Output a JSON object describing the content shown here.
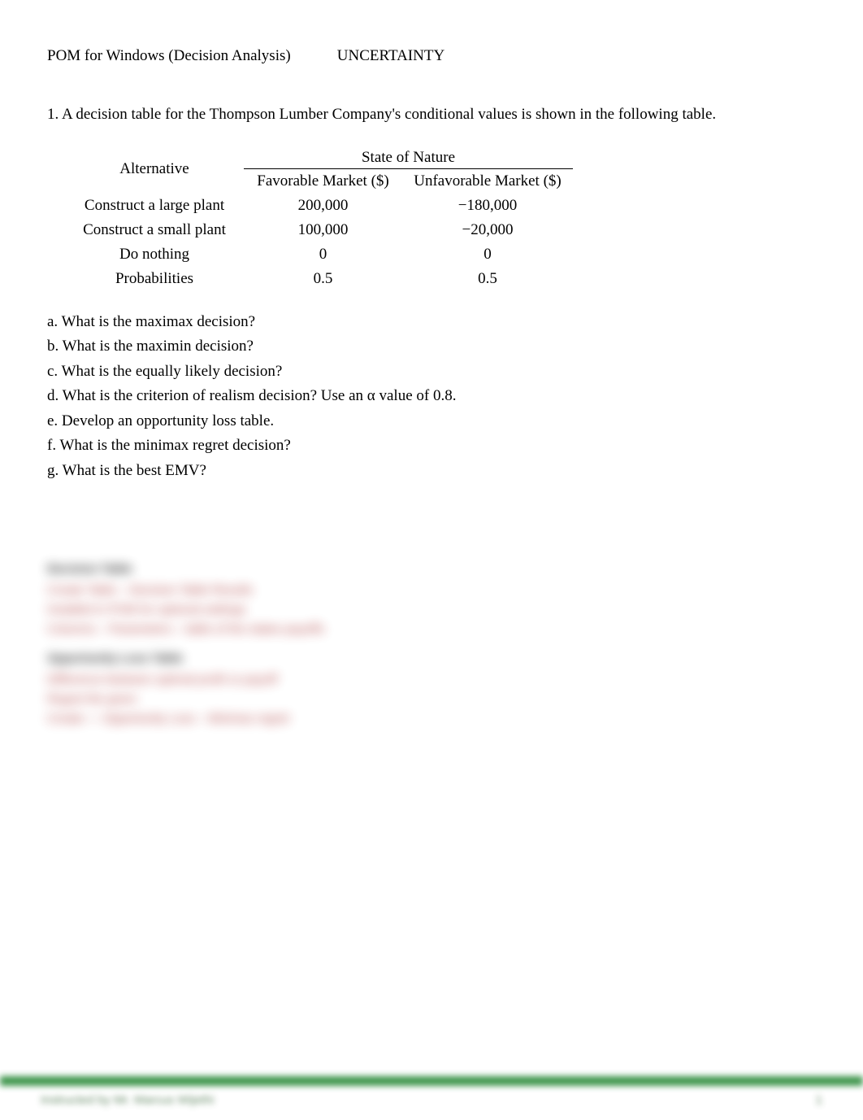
{
  "header": {
    "left": "POM for Windows (Decision Analysis)",
    "right": "UNCERTAINTY"
  },
  "problem_statement": "1. A decision table for the Thompson Lumber Company's conditional values is shown in the following table.",
  "table": {
    "alt_label": "Alternative",
    "son_label": "State of Nature",
    "fav_label": "Favorable Market ($)",
    "unfav_label": "Unfavorable Market ($)",
    "rows": [
      {
        "label": "Construct a large plant",
        "fav": "200,000",
        "unfav": "−180,000"
      },
      {
        "label": "Construct a small plant",
        "fav": "100,000",
        "unfav": "−20,000"
      },
      {
        "label": "Do nothing",
        "fav": "0",
        "unfav": "0"
      },
      {
        "label": "Probabilities",
        "fav": "0.5",
        "unfav": "0.5"
      }
    ]
  },
  "questions": {
    "a": "a. What is the maximax decision?",
    "b": "b. What is the maximin decision?",
    "c": "c. What is the equally likely decision?",
    "d": "d. What is the criterion of realism decision? Use an α value of 0.8.",
    "e": "e. Develop an opportunity loss table.",
    "f": "f. What is the minimax regret decision?",
    "g": "g. What is the best EMV?"
  },
  "blurred": {
    "grp1_label": "Decision Table",
    "grp1_l1": "Create Table – Decision Table Results",
    "grp1_l2": "Installed in POM for optional settings",
    "grp1_l3": "Columns – Parameters – table of the states payoffs",
    "grp2_label": "Opportunity Loss Table",
    "grp2_l1": "Difference between optimal profit vs payoff",
    "grp2_l2": "Regret the given",
    "grp2_l3": "Create — Opportunity Loss – Minimax regret"
  },
  "footer": {
    "left": "Instructed by Mr. Marcus Wijethi",
    "page": "1"
  }
}
